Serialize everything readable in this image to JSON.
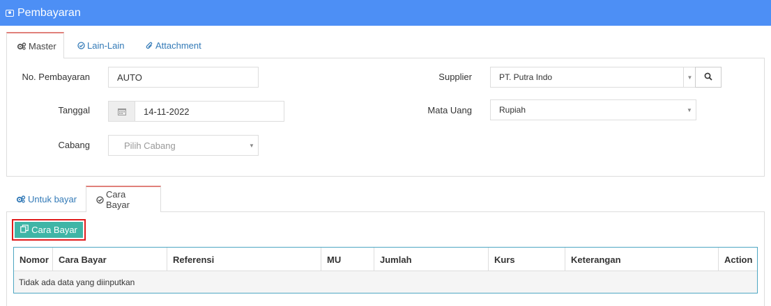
{
  "header": {
    "title": "Pembayaran",
    "icon": "money-icon"
  },
  "master_tabs": [
    {
      "label": "Master",
      "icon": "cogs-icon",
      "active": true
    },
    {
      "label": "Lain-Lain",
      "icon": "check-circle-icon",
      "active": false
    },
    {
      "label": "Attachment",
      "icon": "paperclip-icon",
      "active": false
    }
  ],
  "form": {
    "no_pembayaran": {
      "label": "No. Pembayaran",
      "value": "AUTO"
    },
    "tanggal": {
      "label": "Tanggal",
      "value": "14-11-2022"
    },
    "cabang": {
      "label": "Cabang",
      "placeholder": "Pilih Cabang"
    },
    "supplier": {
      "label": "Supplier",
      "value": "PT. Putra Indo"
    },
    "mata_uang": {
      "label": "Mata Uang",
      "value": "Rupiah"
    }
  },
  "detail_tabs": [
    {
      "label": "Untuk bayar",
      "icon": "cogs-icon",
      "active": false
    },
    {
      "label": "Cara Bayar",
      "icon": "check-circle-icon",
      "active": true
    }
  ],
  "cara_bayar_button": {
    "label": "Cara Bayar",
    "icon": "copy-icon"
  },
  "table": {
    "columns": [
      "Nomor",
      "Cara Bayar",
      "Referensi",
      "MU",
      "Jumlah",
      "Kurs",
      "Keterangan",
      "Action"
    ],
    "empty_text": "Tidak ada data yang diinputkan"
  }
}
